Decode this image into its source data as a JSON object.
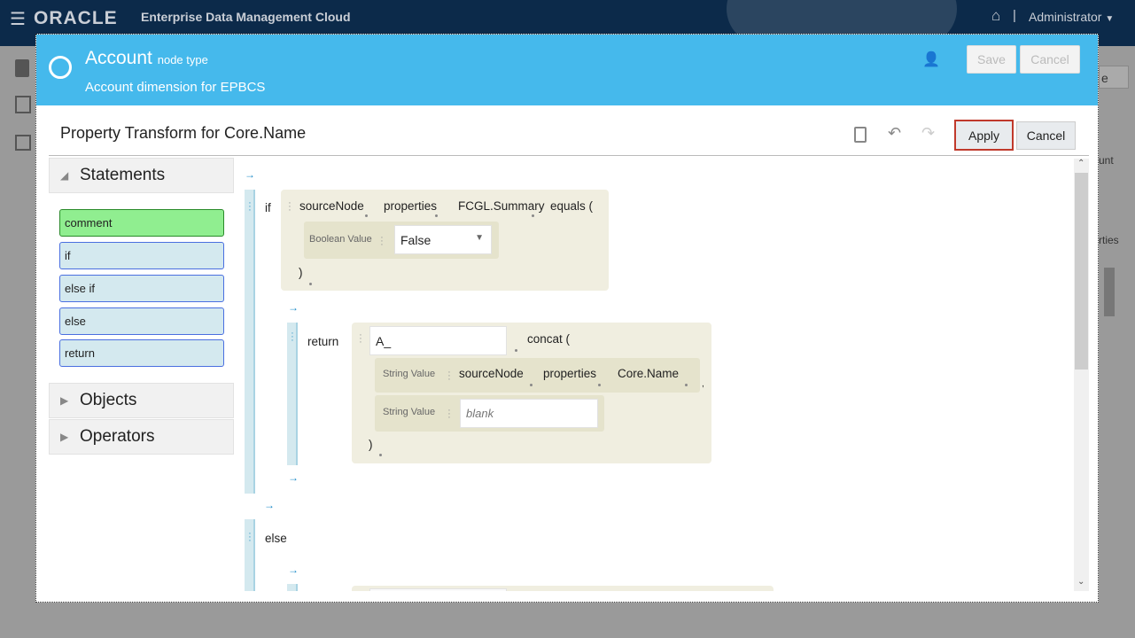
{
  "topbar": {
    "brand": "ORACLE",
    "app_title": "Enterprise Data Management Cloud",
    "user": "Administrator"
  },
  "background": {
    "btn_fragment": "e",
    "text1": "unt",
    "text2": "rties"
  },
  "modal": {
    "title": "Account",
    "title_suffix": "node type",
    "subtitle": "Account dimension for EPBCS",
    "save": "Save",
    "cancel": "Cancel"
  },
  "transform": {
    "title": "Property Transform for Core.Name",
    "apply": "Apply",
    "cancel": "Cancel"
  },
  "palette": {
    "statements": "Statements",
    "items": [
      "comment",
      "if",
      "else if",
      "else",
      "return"
    ],
    "objects": "Objects",
    "operators": "Operators"
  },
  "editor": {
    "arrow": "→",
    "if_kw": "if",
    "cond": {
      "tokens": [
        "sourceNode",
        "properties",
        "FCGL.Summary",
        "equals ("
      ],
      "param_label": "Boolean Value",
      "param_value": "False",
      "close": ")"
    },
    "return_kw": "return",
    "ret": {
      "input": "A_",
      "method": "concat (",
      "p1_label": "String Value",
      "p1_tokens": [
        "sourceNode",
        "properties",
        "Core.Name"
      ],
      "comma": ",",
      "p2_label": "String Value",
      "p2_placeholder": "blank",
      "close": ")"
    },
    "else_kw": "else"
  },
  "colors": {
    "header": "#45b9ec",
    "topbar": "#0c2a4a",
    "comment": "#90ee90",
    "statement": "#d4e9ef",
    "apply_border": "#c0392b"
  }
}
